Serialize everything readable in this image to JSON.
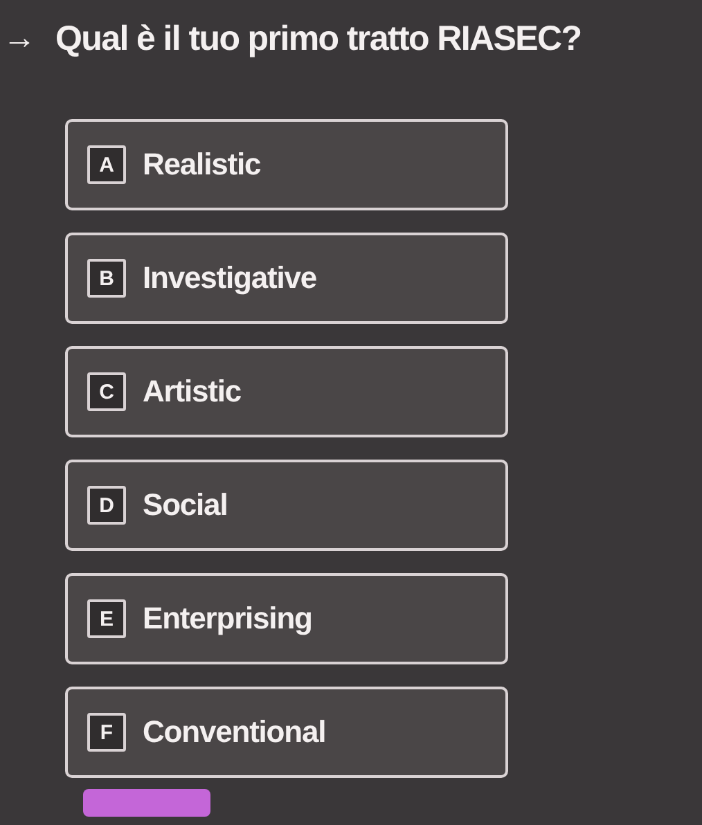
{
  "question": {
    "arrow": "→",
    "text": "Qual è il tuo primo tratto RIASEC?"
  },
  "options": [
    {
      "key": "A",
      "label": "Realistic"
    },
    {
      "key": "B",
      "label": "Investigative"
    },
    {
      "key": "C",
      "label": "Artistic"
    },
    {
      "key": "D",
      "label": "Social"
    },
    {
      "key": "E",
      "label": "Enterprising"
    },
    {
      "key": "F",
      "label": "Conventional"
    }
  ]
}
